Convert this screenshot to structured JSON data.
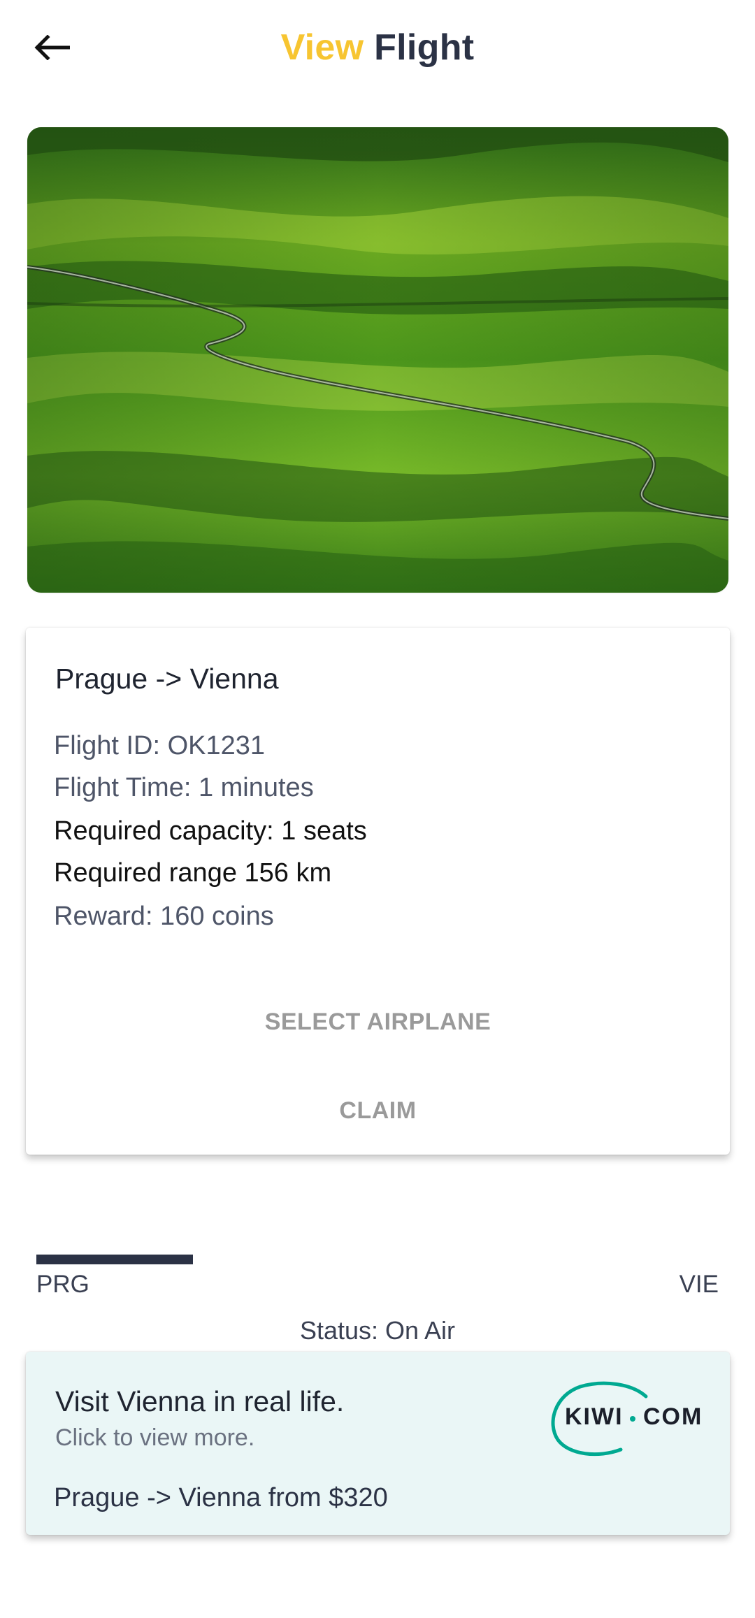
{
  "header": {
    "title_accent": "View",
    "title_main": "Flight",
    "back_icon": "arrow-left-icon",
    "accent_color": "#f7c531",
    "title_color": "#2b3245"
  },
  "flight": {
    "route": "Prague -> Vienna",
    "flight_id": "Flight ID: OK1231",
    "flight_time": "Flight Time: 1 minutes",
    "required_capacity": "Required capacity: 1 seats",
    "required_range": "Required range 156 km",
    "reward": "Reward: 160 coins",
    "select_airplane_label": "SELECT AIRPLANE",
    "claim_label": "CLAIM"
  },
  "progress": {
    "from_code": "PRG",
    "to_code": "VIE",
    "fraction": 0.23,
    "status": "Status: On Air",
    "fill_color": "#2b3245"
  },
  "ad": {
    "title": "Visit Vienna in real life.",
    "subtitle": "Click to view more.",
    "offer": "Prague -> Vienna from $320",
    "logo_kiwi": "KIWI",
    "logo_com": "COM",
    "brand_color": "#00a991",
    "background": "#eaf6f6"
  }
}
